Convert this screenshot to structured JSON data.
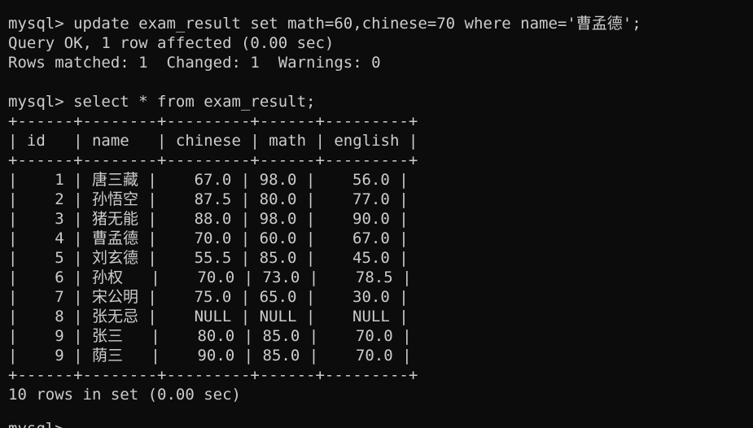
{
  "terminal": {
    "lines": [
      "mysql> update exam_result set math=60,chinese=70 where name='曹孟德';",
      "Query OK, 1 row affected (0.00 sec)",
      "Rows matched: 1  Changed: 1  Warnings: 0",
      "",
      "mysql> select * from exam_result;",
      "+------+--------+---------+------+---------+",
      "| id   | name   | chinese | math | english |",
      "+------+--------+---------+------+---------+",
      "|    1 | 唐三藏 |    67.0 | 98.0 |    56.0 |",
      "|    2 | 孙悟空 |    87.5 | 80.0 |    77.0 |",
      "|    3 | 猪无能 |    88.0 | 98.0 |    90.0 |",
      "|    4 | 曹孟德 |    70.0 | 60.0 |    67.0 |",
      "|    5 | 刘玄德 |    55.5 | 85.0 |    45.0 |",
      "|    6 | 孙权   |    70.0 | 73.0 |    78.5 |",
      "|    7 | 宋公明 |    75.0 | 65.0 |    30.0 |",
      "|    8 | 张无忌 |    NULL | NULL |    NULL |",
      "|    9 | 张三   |    80.0 | 85.0 |    70.0 |",
      "|    9 | 荫三   |    90.0 | 85.0 |    70.0 |",
      "+------+--------+---------+------+---------+",
      "10 rows in set (0.00 sec)",
      "",
      "mysql>"
    ]
  },
  "colors": {
    "background": "#0c0c0c",
    "text": "#cccccc"
  }
}
